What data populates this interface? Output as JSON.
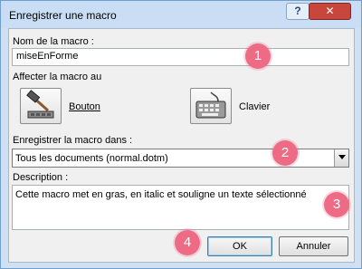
{
  "window": {
    "title": "Enregistrer une macro",
    "help": "?",
    "close": "✕"
  },
  "macro_name": {
    "label": "Nom de la macro :",
    "value": "miseEnForme"
  },
  "assign": {
    "label": "Affecter la macro au",
    "button_label": "Bouton",
    "keyboard_label": "Clavier"
  },
  "store": {
    "label": "Enregistrer la macro dans :",
    "value": "Tous les documents (normal.dotm)"
  },
  "description": {
    "label": "Description :",
    "value": "Cette macro met en gras, en italic et souligne un texte sélectionné"
  },
  "buttons": {
    "ok": "OK",
    "cancel": "Annuler"
  },
  "badges": [
    "1",
    "2",
    "3",
    "4"
  ],
  "colors": {
    "badge": "#ee6b86",
    "titlebar": "#c9def4",
    "close": "#c9463d"
  }
}
